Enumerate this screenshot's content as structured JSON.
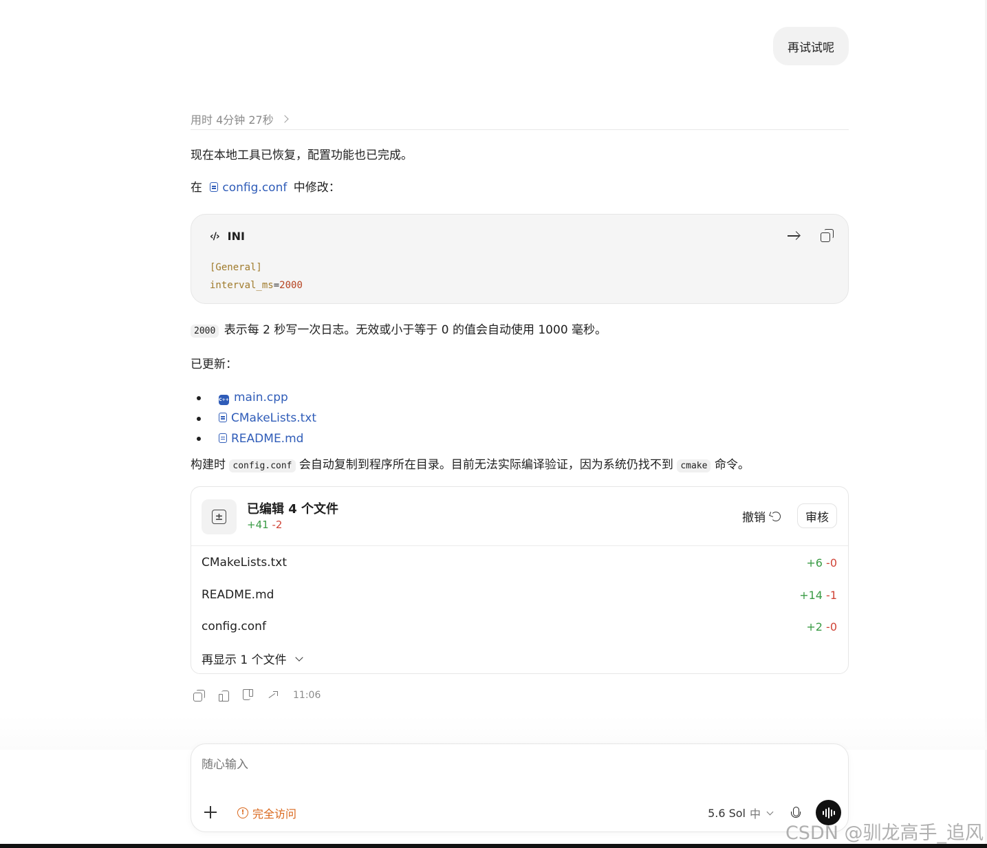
{
  "user_message": "再试试呢",
  "elapsed": "用时 4分钟 27秒",
  "reply": {
    "intro": "现在本地工具已恢复，配置功能也已完成。",
    "modify_prefix": "在",
    "modify_file": "config.conf",
    "modify_suffix": "中修改：",
    "code_block": {
      "language": "INI",
      "line1": "[General]",
      "line2_key": "interval_ms",
      "line2_eq": "=",
      "line2_value": "2000"
    },
    "explain_code": "2000",
    "explain_text": "表示每 2 秒写一次日志。无效或小于等于 0 的值会自动使用 1000 毫秒。",
    "updated_label": "已更新：",
    "updated_files": [
      "main.cpp",
      "CMakeLists.txt",
      "README.md"
    ],
    "build_prefix": "构建时",
    "build_code1": "config.conf",
    "build_middle": "会自动复制到程序所在目录。目前无法实际编译验证，因为系统仍找不到",
    "build_code2": "cmake",
    "build_suffix": "命令。"
  },
  "edit_card": {
    "title": "已编辑 4 个文件",
    "added": "+41",
    "removed": "-2",
    "undo_label": "撤销",
    "review_label": "审核",
    "files": [
      {
        "name": "CMakeLists.txt",
        "added": "+6",
        "removed": "-0"
      },
      {
        "name": "README.md",
        "added": "+14",
        "removed": "-1"
      },
      {
        "name": "config.conf",
        "added": "+2",
        "removed": "-0"
      }
    ],
    "show_more": "再显示 1 个文件"
  },
  "message_time": "11:06",
  "composer": {
    "placeholder": "随心输入",
    "access_label": "完全访问",
    "model": "5.6 Sol",
    "level": "中"
  },
  "watermark": "CSDN @驯龙高手_追风",
  "colors": {
    "link": "#2f5cb8",
    "added": "#3a9b45",
    "removed": "#d04437",
    "access": "#d9661a"
  }
}
